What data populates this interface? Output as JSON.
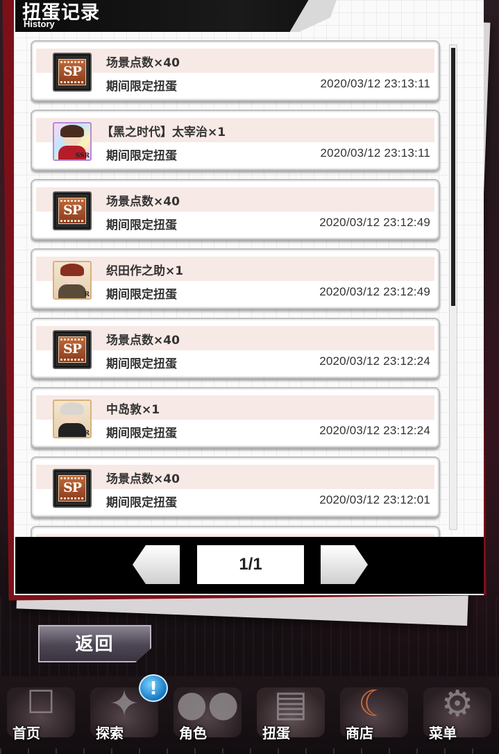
{
  "header": {
    "title": "扭蛋记录",
    "subtitle": "History"
  },
  "records": [
    {
      "icon": "sp-icon",
      "name": "场景点数×40",
      "source": "期间限定扭蛋",
      "time": "2020/03/12 23:13:11"
    },
    {
      "icon": "character-dazai-ssr-icon",
      "rarity": "SSR",
      "name": "【黑之时代】太宰治×1",
      "source": "期间限定扭蛋",
      "time": "2020/03/12 23:13:11"
    },
    {
      "icon": "sp-icon",
      "name": "场景点数×40",
      "source": "期间限定扭蛋",
      "time": "2020/03/12 23:12:49"
    },
    {
      "icon": "character-oda-r-icon",
      "rarity": "R",
      "name": "织田作之助×1",
      "source": "期间限定扭蛋",
      "time": "2020/03/12 23:12:49"
    },
    {
      "icon": "sp-icon",
      "name": "场景点数×40",
      "source": "期间限定扭蛋",
      "time": "2020/03/12 23:12:24"
    },
    {
      "icon": "character-atsushi-r-icon",
      "rarity": "R",
      "name": "中岛敦×1",
      "source": "期间限定扭蛋",
      "time": "2020/03/12 23:12:24"
    },
    {
      "icon": "sp-icon",
      "name": "场景点数×40",
      "source": "期间限定扭蛋",
      "time": "2020/03/12 23:12:01"
    }
  ],
  "sp_label": "SP",
  "pager": {
    "page": "1/1"
  },
  "back_button": "返回",
  "nav": [
    {
      "label": "首页",
      "icon": "bungo-stray-dogs-logo-icon"
    },
    {
      "label": "探索",
      "icon": "explore-icon"
    },
    {
      "label": "角色",
      "icon": "characters-icon"
    },
    {
      "label": "扭蛋",
      "icon": "gacha-book-icon"
    },
    {
      "label": "商店",
      "icon": "shop-moon-icon"
    },
    {
      "label": "菜单",
      "icon": "gear-icon"
    }
  ],
  "notification_badge": "!"
}
